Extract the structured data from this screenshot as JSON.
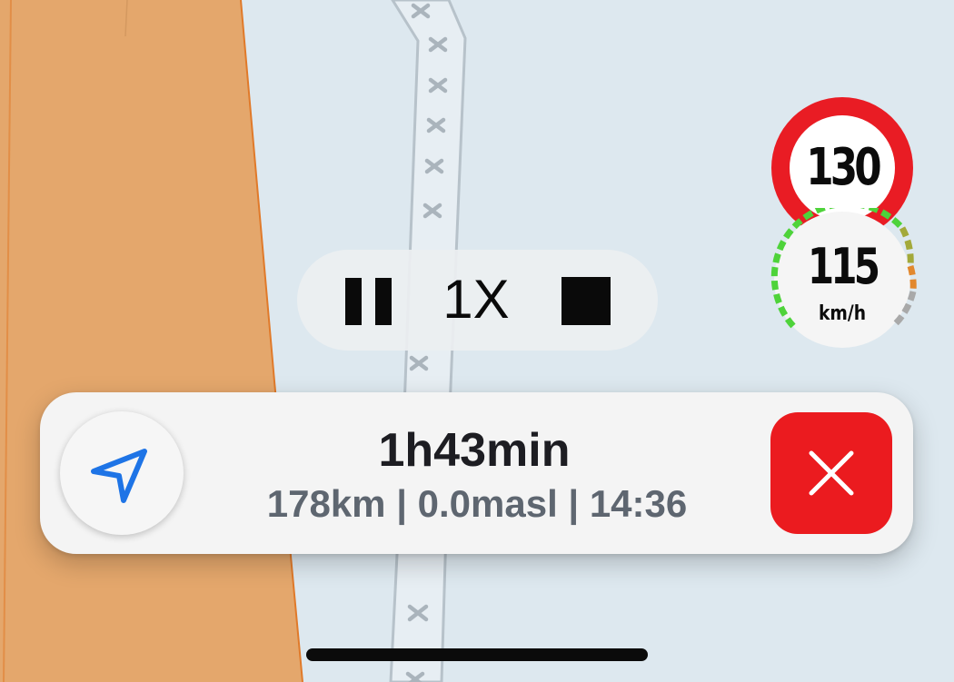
{
  "map": {
    "land_color": "#e4a76c",
    "water_color": "#dde8ef",
    "border_line_color": "#e07a2a",
    "path_color": "#e7eef3",
    "path_edge_color": "#b7c2ca",
    "path_marker_color": "#aab4bc"
  },
  "playback": {
    "pause_icon": "pause-icon",
    "speed_label": "1X",
    "stop_icon": "stop-icon"
  },
  "speed_limit": {
    "value": "130",
    "ring_color": "#e91c24"
  },
  "speedometer": {
    "value": "115",
    "unit": "km/h"
  },
  "route": {
    "recenter_icon": "navigation-arrow-icon",
    "arrow_color": "#1e74e6",
    "eta": "1h43min",
    "details": "178km | 0.0masl | 14:36",
    "close_icon": "close-icon",
    "close_color": "#eb1b1f"
  }
}
